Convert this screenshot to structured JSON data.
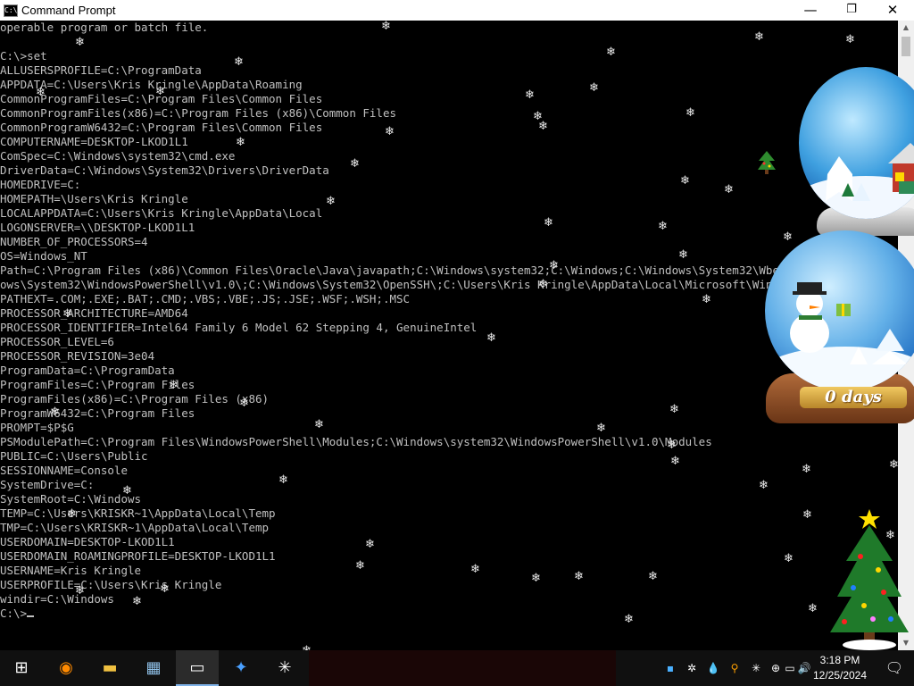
{
  "window": {
    "title": "Command Prompt",
    "app_icon_text": "C:\\",
    "controls": {
      "minimize": "—",
      "maximize": "❐",
      "close": "✕"
    }
  },
  "console": {
    "lines": [
      "operable program or batch file.",
      "",
      "C:\\>set",
      "ALLUSERSPROFILE=C:\\ProgramData",
      "APPDATA=C:\\Users\\Kris Kringle\\AppData\\Roaming",
      "CommonProgramFiles=C:\\Program Files\\Common Files",
      "CommonProgramFiles(x86)=C:\\Program Files (x86)\\Common Files",
      "CommonProgramW6432=C:\\Program Files\\Common Files",
      "COMPUTERNAME=DESKTOP-LKOD1L1",
      "ComSpec=C:\\Windows\\system32\\cmd.exe",
      "DriverData=C:\\Windows\\System32\\Drivers\\DriverData",
      "HOMEDRIVE=C:",
      "HOMEPATH=\\Users\\Kris Kringle",
      "LOCALAPPDATA=C:\\Users\\Kris Kringle\\AppData\\Local",
      "LOGONSERVER=\\\\DESKTOP-LKOD1L1",
      "NUMBER_OF_PROCESSORS=4",
      "OS=Windows_NT",
      "Path=C:\\Program Files (x86)\\Common Files\\Oracle\\Java\\javapath;C:\\Windows\\system32;C:\\Windows;C:\\Windows\\System32\\Wbem;C:\\Windows\\System32\\Wind",
      "ows\\System32\\WindowsPowerShell\\v1.0\\;C:\\Windows\\System32\\OpenSSH\\;C:\\Users\\Kris Kringle\\AppData\\Local\\Microsoft\\WindowsApps;",
      "PATHEXT=.COM;.EXE;.BAT;.CMD;.VBS;.VBE;.JS;.JSE;.WSF;.WSH;.MSC",
      "PROCESSOR_ARCHITECTURE=AMD64",
      "PROCESSOR_IDENTIFIER=Intel64 Family 6 Model 62 Stepping 4, GenuineIntel",
      "PROCESSOR_LEVEL=6",
      "PROCESSOR_REVISION=3e04",
      "ProgramData=C:\\ProgramData",
      "ProgramFiles=C:\\Program Files",
      "ProgramFiles(x86)=C:\\Program Files (x86)",
      "ProgramW6432=C:\\Program Files",
      "PROMPT=$P$G",
      "PSModulePath=C:\\Program Files\\WindowsPowerShell\\Modules;C:\\Windows\\system32\\WindowsPowerShell\\v1.0\\Modules",
      "PUBLIC=C:\\Users\\Public",
      "SESSIONNAME=Console",
      "SystemDrive=C:",
      "SystemRoot=C:\\Windows",
      "TEMP=C:\\Users\\KRISKR~1\\AppData\\Local\\Temp",
      "TMP=C:\\Users\\KRISKR~1\\AppData\\Local\\Temp",
      "USERDOMAIN=DESKTOP-LKOD1L1",
      "USERDOMAIN_ROAMINGPROFILE=DESKTOP-LKOD1L1",
      "USERNAME=Kris Kringle",
      "USERPROFILE=C:\\Users\\Kris Kringle",
      "windir=C:\\Windows",
      ""
    ],
    "prompt": "C:\\>"
  },
  "desktop_overlay": {
    "countdown_label": "0 days",
    "snowflake_glyph": "❄"
  },
  "taskbar": {
    "items": [
      {
        "name": "start-button",
        "icon": "windows-logo-icon",
        "glyph": "⊞"
      },
      {
        "name": "firefox-taskbar-button",
        "icon": "firefox-icon",
        "glyph": "◉"
      },
      {
        "name": "file-explorer-taskbar-button",
        "icon": "folder-icon",
        "glyph": "▬"
      },
      {
        "name": "control-panel-taskbar-button",
        "icon": "control-panel-icon",
        "glyph": "▦"
      },
      {
        "name": "command-prompt-taskbar-button",
        "icon": "terminal-icon",
        "glyph": "▭"
      },
      {
        "name": "app-taskbar-button",
        "icon": "app-icon",
        "glyph": "✦"
      },
      {
        "name": "snowflake-taskbar-button",
        "icon": "snowflake-icon",
        "glyph": "✳"
      }
    ],
    "tray": {
      "glyphs": [
        "▪",
        "✲",
        "💧",
        "⚲",
        "✳",
        "⊕",
        "▭",
        "🔊"
      ],
      "time": "3:18 PM",
      "date": "12/25/2024",
      "notifications_glyph": "🗨"
    }
  }
}
